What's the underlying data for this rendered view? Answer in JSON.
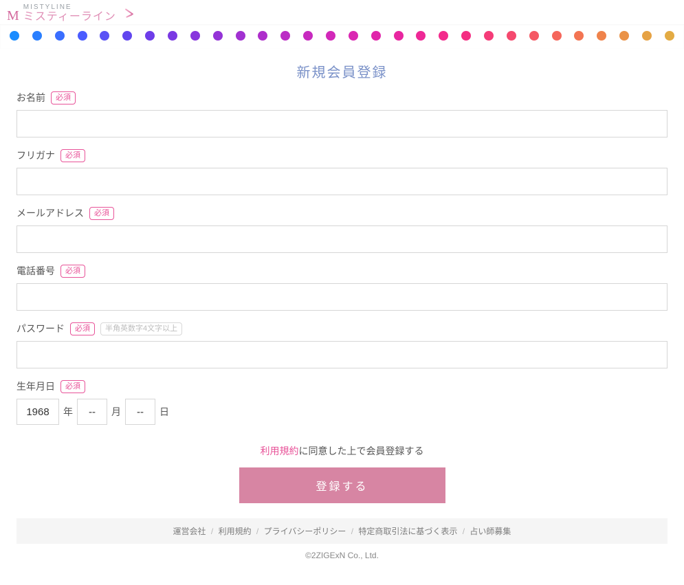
{
  "brand": {
    "en": "MISTYLINE",
    "jp": "ミスティーライン"
  },
  "dot_colors": [
    "#1a8cff",
    "#2a7fff",
    "#3a6eff",
    "#4a5cff",
    "#5a52f5",
    "#6146ef",
    "#6e3de9",
    "#7a39e3",
    "#8836dd",
    "#9433d7",
    "#a131d1",
    "#ae2ecb",
    "#bb2cc5",
    "#c72abf",
    "#d228b9",
    "#da27b2",
    "#e025aa",
    "#e826a0",
    "#ee2896",
    "#f32a8c",
    "#f42d82",
    "#f53b78",
    "#f5496e",
    "#f55864",
    "#f5665b",
    "#f37452",
    "#ef834b",
    "#ea9247",
    "#e6a244",
    "#e3ab43"
  ],
  "page_title": "新規会員登録",
  "required_label": "必須",
  "fields": {
    "name": {
      "label": "お名前",
      "value": ""
    },
    "kana": {
      "label": "フリガナ",
      "value": ""
    },
    "email": {
      "label": "メールアドレス",
      "value": ""
    },
    "phone": {
      "label": "電話番号",
      "value": ""
    },
    "password": {
      "label": "パスワード",
      "value": "",
      "hint": "半角英数字4文字以上"
    },
    "birth": {
      "label": "生年月日",
      "year_value": "1968",
      "month_value": "--",
      "day_value": "--",
      "suffix_year": "年",
      "suffix_month": "月",
      "suffix_day": "日"
    }
  },
  "consent": {
    "tos_link": "利用規約",
    "tail": "に同意した上で会員登録する"
  },
  "submit_label": "登録する",
  "footer_links": [
    "運営会社",
    "利用規約",
    "プライバシーポリシー",
    "特定商取引法に基づく表示",
    "占い師募集"
  ],
  "footer_sep": "/",
  "copyright": "©2ZIGExN Co., Ltd."
}
